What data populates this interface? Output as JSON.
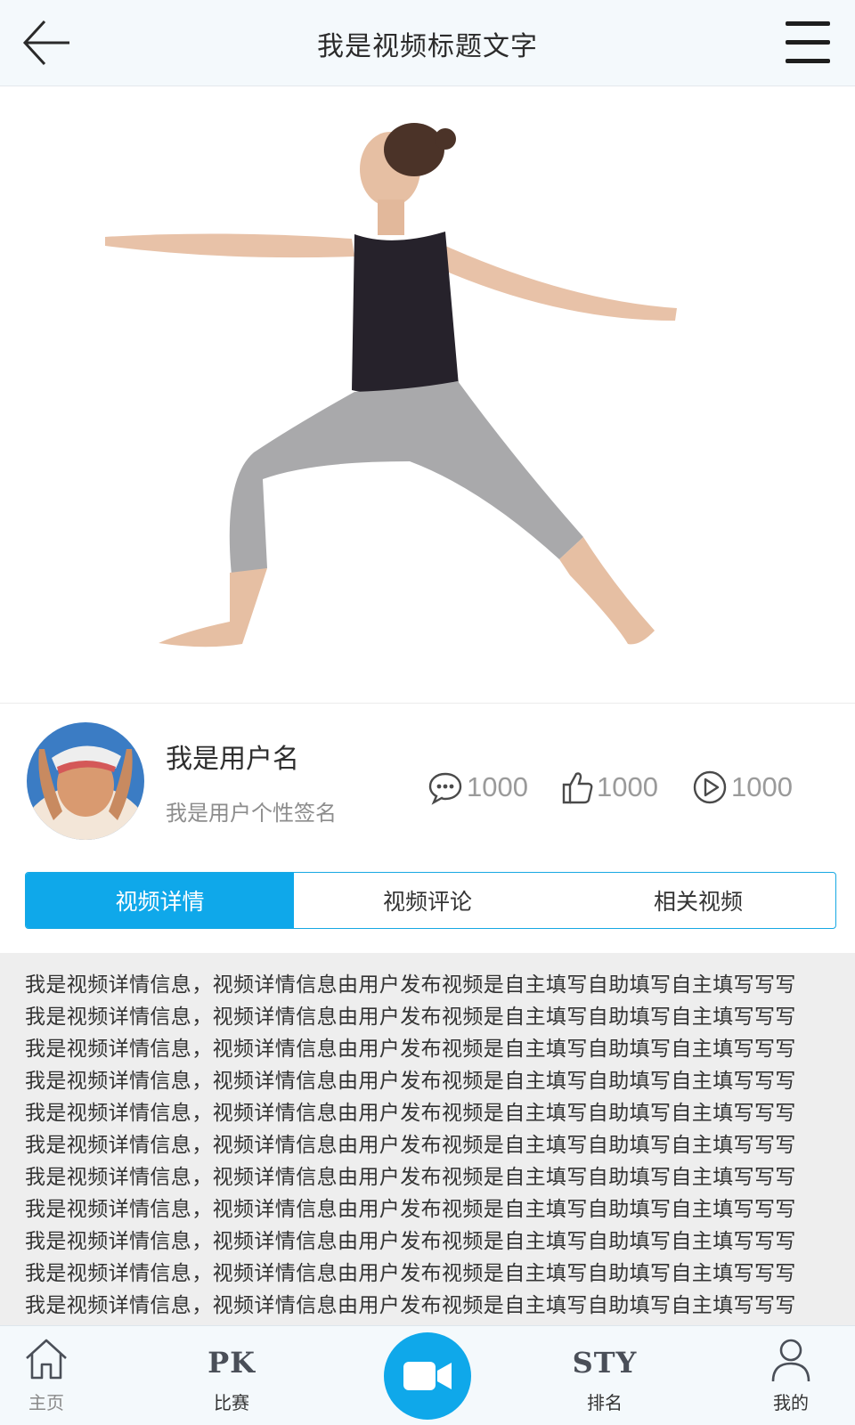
{
  "header": {
    "title": "我是视频标题文字"
  },
  "user": {
    "name": "我是用户名",
    "signature": "我是用户个性签名"
  },
  "stats": {
    "comments": "1000",
    "likes": "1000",
    "plays": "1000"
  },
  "tabs": [
    {
      "label": "视频详情",
      "active": true
    },
    {
      "label": "视频评论",
      "active": false
    },
    {
      "label": "相关视频",
      "active": false
    }
  ],
  "details": {
    "lines": [
      "我是视频详情信息，视频详情信息由用户发布视频是自主填写自助填写自主填写写写",
      "我是视频详情信息，视频详情信息由用户发布视频是自主填写自助填写自主填写写写",
      "我是视频详情信息，视频详情信息由用户发布视频是自主填写自助填写自主填写写写",
      "我是视频详情信息，视频详情信息由用户发布视频是自主填写自助填写自主填写写写",
      "我是视频详情信息，视频详情信息由用户发布视频是自主填写自助填写自主填写写写",
      "我是视频详情信息，视频详情信息由用户发布视频是自主填写自助填写自主填写写写",
      "我是视频详情信息，视频详情信息由用户发布视频是自主填写自助填写自主填写写写",
      "我是视频详情信息，视频详情信息由用户发布视频是自主填写自助填写自主填写写写",
      "我是视频详情信息，视频详情信息由用户发布视频是自主填写自助填写自主填写写写",
      "我是视频详情信息，视频详情信息由用户发布视频是自主填写自助填写自主填写写写",
      "我是视频详情信息，视频详情信息由用户发布视频是自主填写自助填写自主填写写写"
    ]
  },
  "bottom_nav": {
    "home": "主页",
    "pk_logo": "PK",
    "pk": "比赛",
    "sty_logo": "STY",
    "rank": "排名",
    "mine": "我的"
  },
  "colors": {
    "accent": "#0fa8ea",
    "header_bg": "#f4f9fc",
    "details_bg": "#eeeeee"
  },
  "icons": {
    "back": "arrow-left-icon",
    "menu": "hamburger-menu-icon",
    "comment": "comment-bubble-icon",
    "like": "thumbs-up-icon",
    "play": "play-circle-icon",
    "home": "home-icon",
    "record": "video-camera-icon",
    "mine": "user-icon"
  }
}
